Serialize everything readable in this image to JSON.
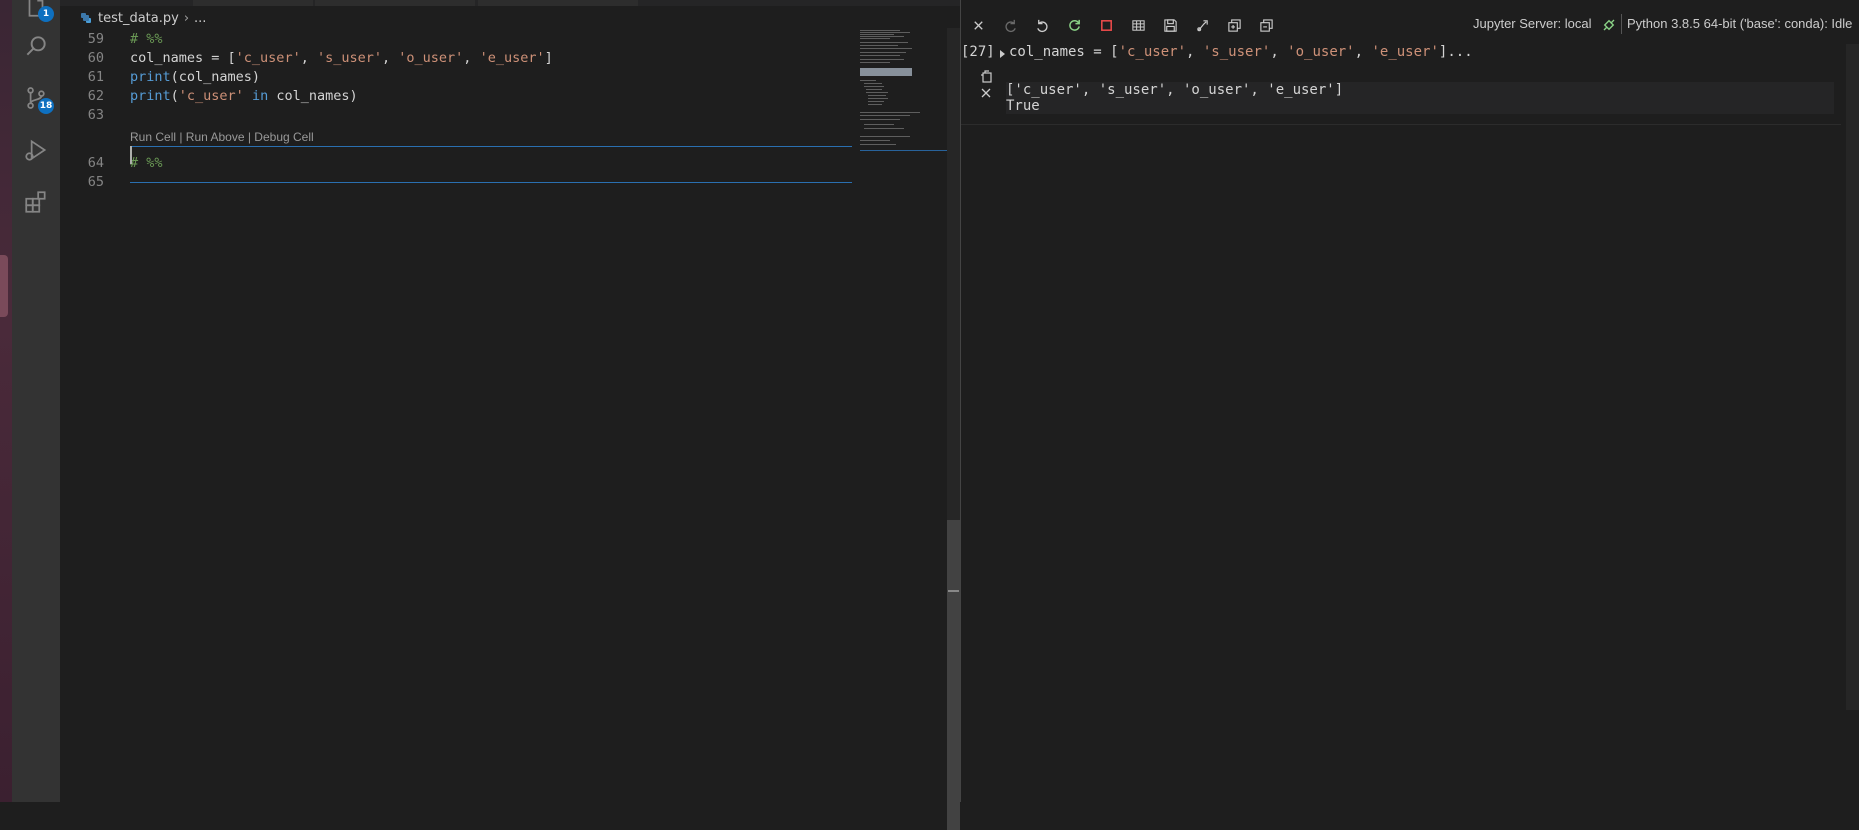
{
  "activity_bar": {
    "explorer_badge": "1",
    "source_control_badge": "18"
  },
  "editor": {
    "breadcrumb": {
      "file": "test_data.py",
      "separator": "›",
      "more": "..."
    },
    "lines": [
      {
        "num": "59",
        "tokens": [
          {
            "t": "# %%",
            "c": "cmt"
          }
        ]
      },
      {
        "num": "60",
        "tokens": [
          {
            "t": "col_names = [",
            "c": "pl"
          },
          {
            "t": "'c_user'",
            "c": "str"
          },
          {
            "t": ", ",
            "c": "pl"
          },
          {
            "t": "'s_user'",
            "c": "str"
          },
          {
            "t": ", ",
            "c": "pl"
          },
          {
            "t": "'o_user'",
            "c": "str"
          },
          {
            "t": ", ",
            "c": "pl"
          },
          {
            "t": "'e_user'",
            "c": "str"
          },
          {
            "t": "]",
            "c": "pl"
          }
        ]
      },
      {
        "num": "61",
        "tokens": [
          {
            "t": "print",
            "c": "kw"
          },
          {
            "t": "(col_names)",
            "c": "pl"
          }
        ]
      },
      {
        "num": "62",
        "tokens": [
          {
            "t": "print",
            "c": "kw"
          },
          {
            "t": "(",
            "c": "pl"
          },
          {
            "t": "'c_user'",
            "c": "str"
          },
          {
            "t": " ",
            "c": "pl"
          },
          {
            "t": "in",
            "c": "kw"
          },
          {
            "t": " col_names)",
            "c": "pl"
          }
        ]
      },
      {
        "num": "63",
        "tokens": []
      },
      {
        "num": "64",
        "tokens": [
          {
            "t": "# %%",
            "c": "cmt"
          }
        ]
      },
      {
        "num": "65",
        "tokens": []
      }
    ],
    "codelens": "Run Cell | Run Above | Debug Cell"
  },
  "jupyter": {
    "server_status": "Jupyter Server: local",
    "kernel_status": "Python 3.8.5 64-bit ('base': conda): Idle",
    "cell": {
      "execution_count": "[27]",
      "code_preview": "col_names = ['c_user', 's_user', 'o_user', 'e_user']...",
      "output_line1": "['c_user', 's_user', 'o_user', 'e_user']",
      "output_line2": "True"
    }
  }
}
